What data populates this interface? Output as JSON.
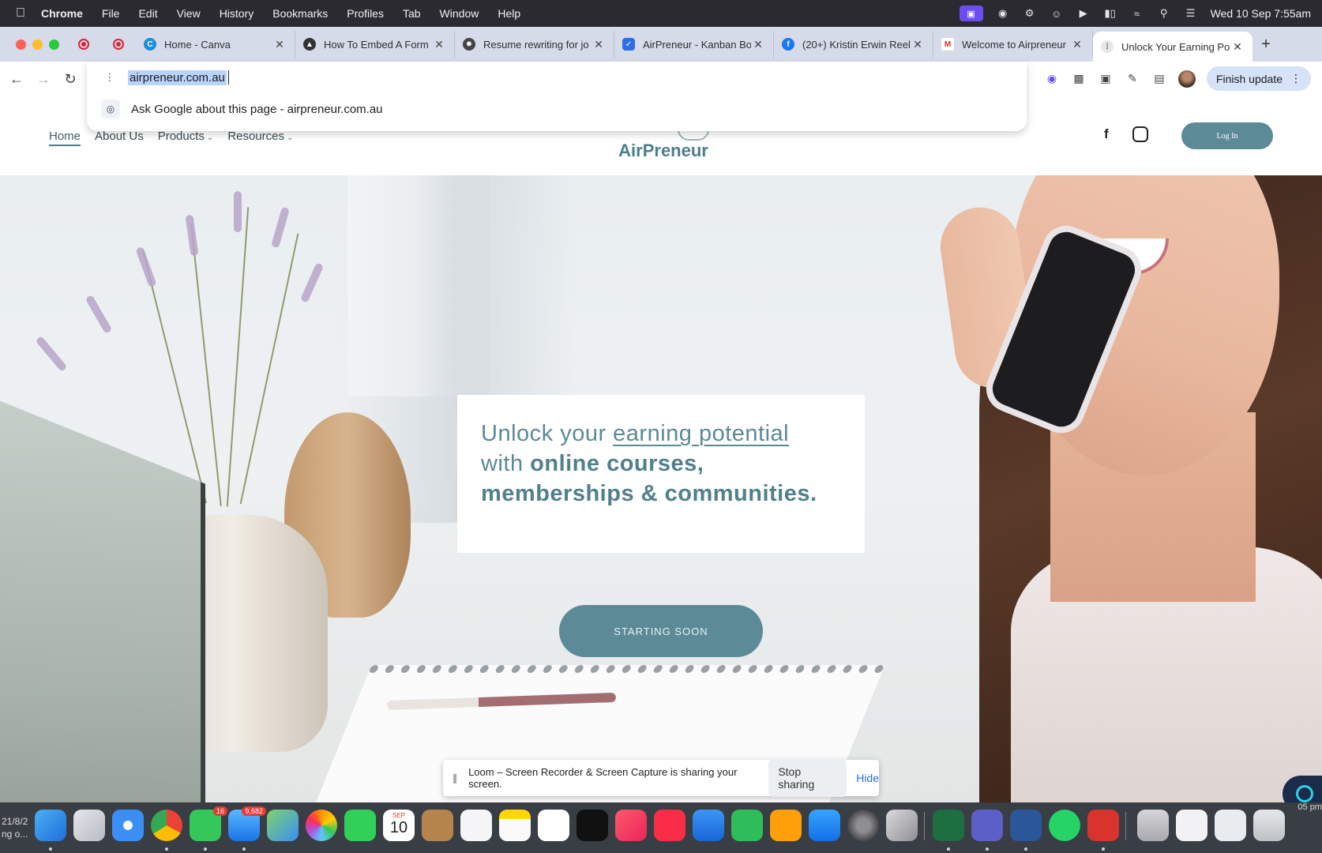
{
  "menubar": {
    "app": "Chrome",
    "items": [
      "File",
      "Edit",
      "View",
      "History",
      "Bookmarks",
      "Profiles",
      "Tab",
      "Window",
      "Help"
    ],
    "clock": "Wed 10 Sep  7:55am"
  },
  "tabs": [
    {
      "title": "Home - Canva",
      "favicon": "canva-icon",
      "color": "#1a8fd8"
    },
    {
      "title": "How To Embed A Form",
      "favicon": "form-icon",
      "color": "#333333"
    },
    {
      "title": "Resume rewriting for jo",
      "favicon": "openai-icon",
      "color": "#444444"
    },
    {
      "title": "AirPreneur - Kanban Bo",
      "favicon": "kanban-icon",
      "color": "#2e6fe0"
    },
    {
      "title": "(20+) Kristin Erwin Reel",
      "favicon": "facebook-icon",
      "color": "#1877f2"
    },
    {
      "title": "Welcome to Airpreneur",
      "favicon": "gmail-icon",
      "color": "#d93025"
    },
    {
      "title": "Unlock Your Earning Po",
      "favicon": "site-icon",
      "color": "#777777",
      "active": true
    }
  ],
  "omnibox": {
    "url": "airpreneur.com.au",
    "suggestion": "Ask Google about this page - airpreneur.com.au"
  },
  "toolbar": {
    "finish_update": "Finish update"
  },
  "site": {
    "nav": [
      {
        "label": "Home",
        "active": true,
        "dropdown": false
      },
      {
        "label": "About Us",
        "dropdown": false
      },
      {
        "label": "Products",
        "dropdown": true
      },
      {
        "label": "Resources",
        "dropdown": true
      }
    ],
    "logo": "AirPreneur",
    "login": "Log In",
    "hero": {
      "line1_plain": "Unlock your ",
      "line1_highlight": "earning potential",
      "line2_plain": "with ",
      "line2_bold": "online courses,",
      "line3_bold": "memberships & communities.",
      "cta": "STARTING SOON"
    },
    "brand_color": "#5c8b97"
  },
  "sharebar": {
    "message": "Loom – Screen Recorder & Screen Capture is sharing your screen.",
    "stop": "Stop sharing",
    "hide": "Hide"
  },
  "dock": {
    "left_text_1": "21/8/2",
    "left_text_2": "ng o...",
    "right_text": "05 pm",
    "calendar_month": "SEP",
    "calendar_day": "10",
    "messages_badge": "16",
    "mail_badge": "9,682"
  }
}
